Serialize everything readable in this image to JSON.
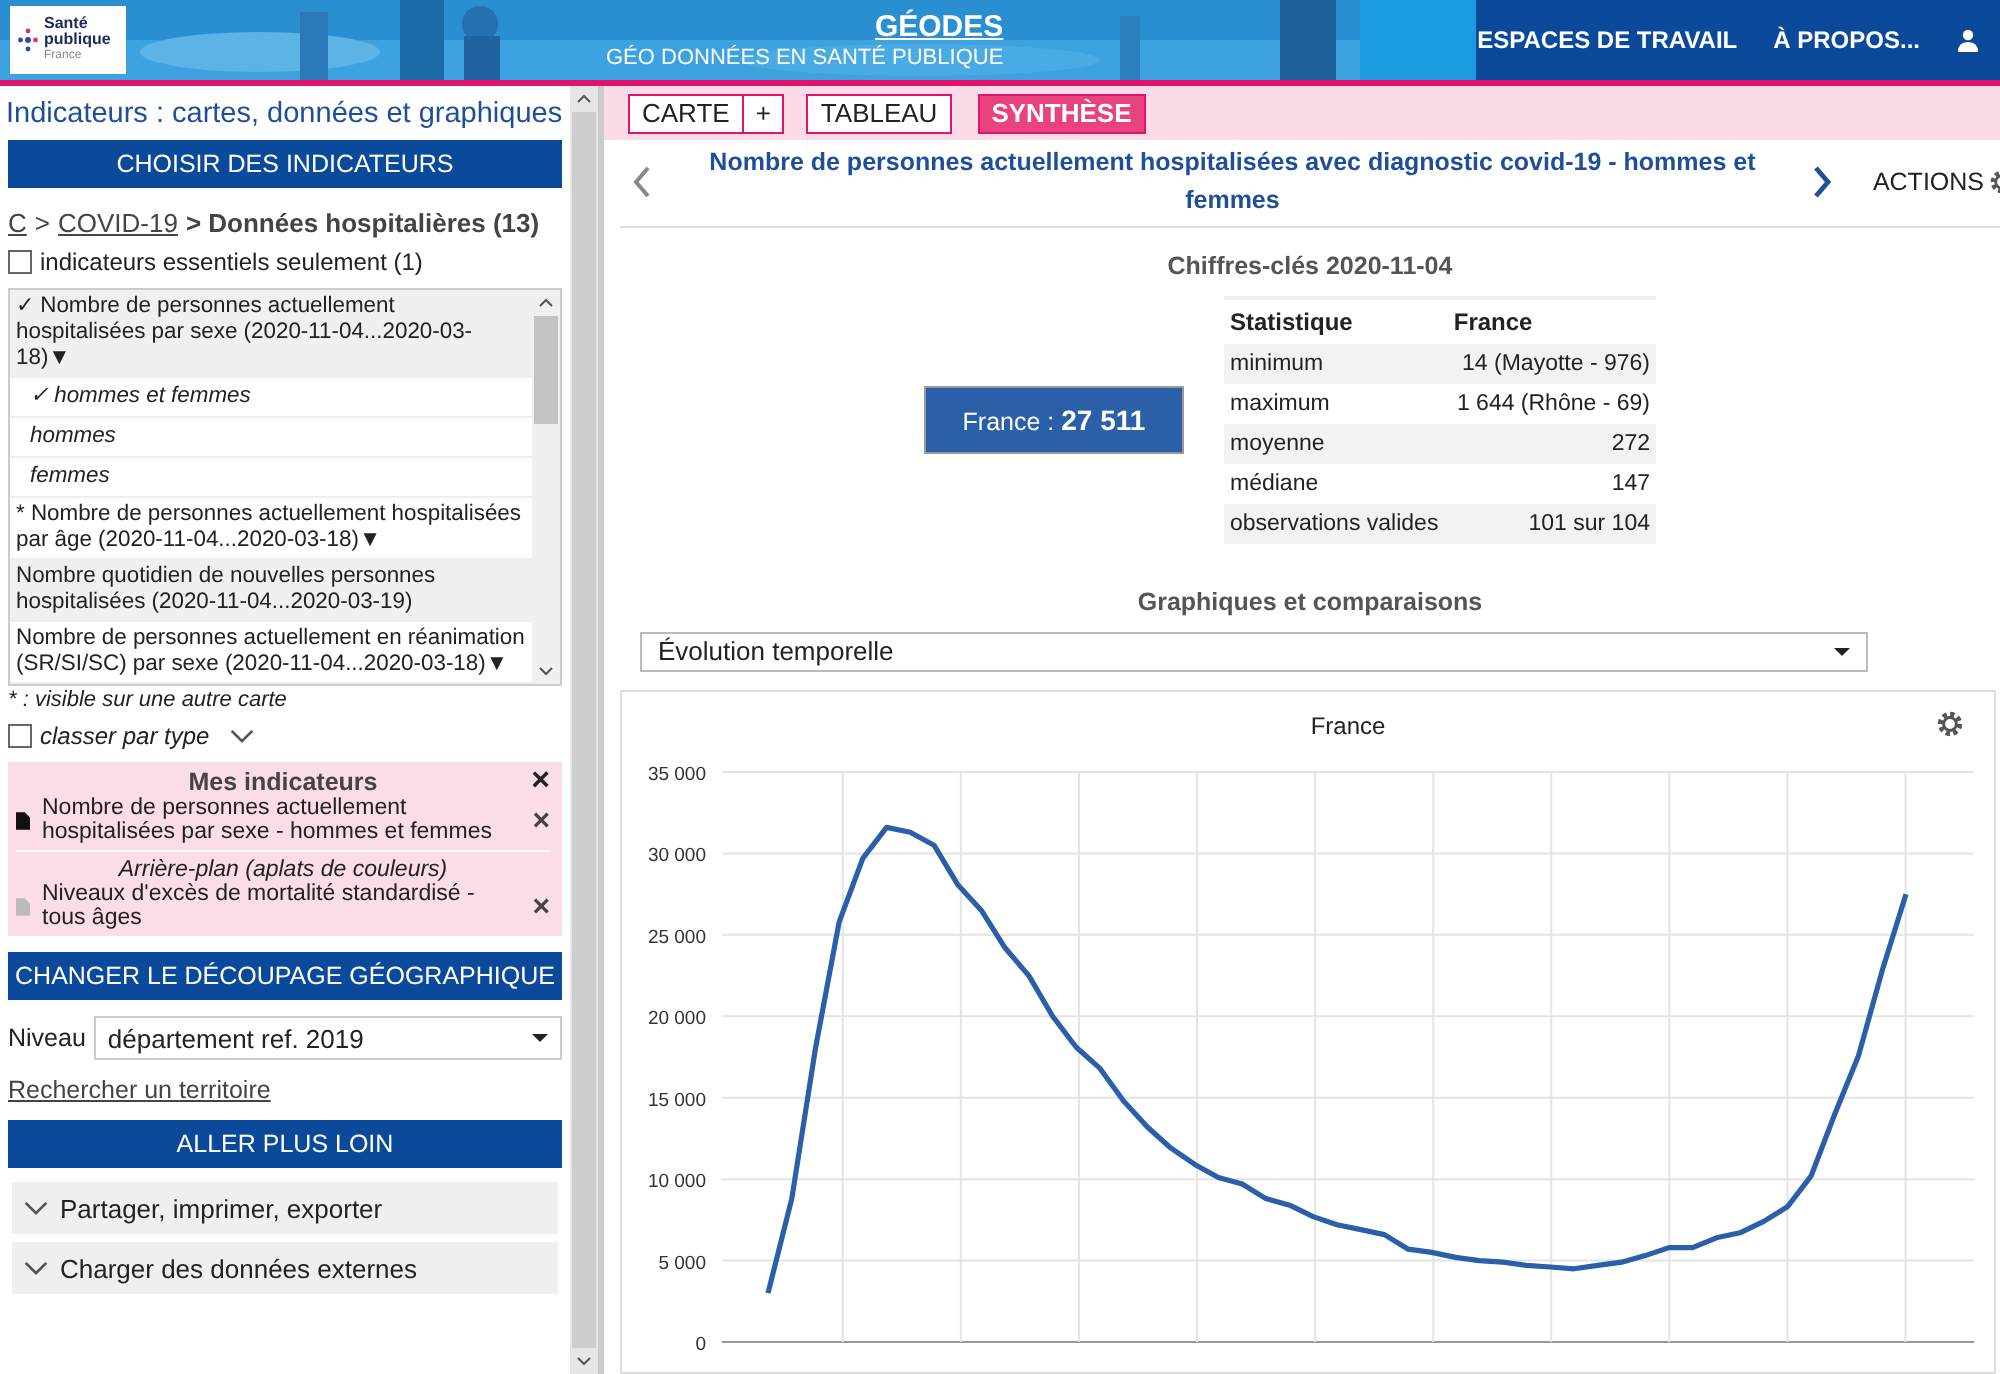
{
  "header": {
    "logo_lines": [
      "Santé",
      "publique",
      "France"
    ],
    "app_title": "GÉODES",
    "app_subtitle": "GÉO DONNÉES EN SANTÉ PUBLIQUE",
    "nav": [
      "ESPACES DE TRAVAIL",
      "À PROPOS..."
    ]
  },
  "sidebar": {
    "title": "Indicateurs : cartes, données et graphiques",
    "choose_button": "CHOISIR DES INDICATEURS",
    "breadcrumb": [
      {
        "text": "C",
        "kind": "link"
      },
      {
        "text": ">",
        "kind": "sep"
      },
      {
        "text": "COVID-19",
        "kind": "link"
      },
      {
        "text": "> Données hospitalières (13)",
        "kind": "current"
      }
    ],
    "essential_filter": {
      "label": "indicateurs essentiels seulement (1)",
      "checked": false
    },
    "indicators": [
      {
        "kind": "group",
        "text": "✓ Nombre de personnes actuellement hospitalisées par sexe (2020-11-04...2020-03-18)",
        "arrow": "▼",
        "shaded": true
      },
      {
        "kind": "option",
        "text": "✓ hommes et femmes"
      },
      {
        "kind": "option",
        "text": "hommes"
      },
      {
        "kind": "option",
        "text": "femmes"
      },
      {
        "kind": "group",
        "text": "* Nombre de personnes actuellement hospitalisées par âge (2020-11-04...2020-03-18)",
        "arrow": "▼",
        "shaded": false
      },
      {
        "kind": "group",
        "text": "Nombre quotidien de nouvelles personnes hospitalisées (2020-11-04...2020-03-19)",
        "shaded": true
      },
      {
        "kind": "group",
        "text": "Nombre de personnes actuellement en réanimation (SR/SI/SC) par sexe (2020-11-04...2020-03-18)",
        "arrow": "▼",
        "shaded": false
      }
    ],
    "footnote": "* : visible sur une autre carte",
    "sort_by_type": {
      "label": "classer par type",
      "checked": false
    },
    "my_indicators": {
      "title": "Mes indicateurs",
      "close": "×",
      "items": [
        {
          "kind": "main",
          "text": "Nombre de personnes actuellement hospitalisées par sexe - hommes et femmes",
          "remove": "×"
        },
        {
          "kind": "background",
          "heading": "Arrière-plan (aplats de couleurs)",
          "text": "Niveaux d'excès de mortalité standardisé - tous âges",
          "remove": "×"
        }
      ]
    },
    "geo_button": "CHANGER LE DÉCOUPAGE GÉOGRAPHIQUE",
    "level": {
      "label": "Niveau",
      "value": "département ref. 2019"
    },
    "search_link": "Rechercher un territoire",
    "more_button": "ALLER PLUS LOIN",
    "accordions": [
      "Partager, imprimer, exporter",
      "Charger des données externes"
    ]
  },
  "main": {
    "tabs": [
      {
        "label": "CARTE",
        "selected": false
      },
      {
        "label": "+",
        "selected": false
      },
      {
        "label": "TABLEAU",
        "selected": false
      },
      {
        "label": "SYNTHÈSE",
        "selected": true
      }
    ],
    "indicator_title": "Nombre de personnes actuellement hospitalisées avec diagnostic covid-19 - hommes et femmes",
    "actions": "ACTIONS",
    "key_figures": {
      "title": "Chiffres-clés 2020-11-04",
      "total_label": "France : ",
      "total_value": "27 511",
      "columns": [
        "Statistique",
        "France"
      ],
      "rows": [
        [
          "minimum",
          "14 (Mayotte - 976)"
        ],
        [
          "maximum",
          "1 644 (Rhône - 69)"
        ],
        [
          "moyenne",
          "272"
        ],
        [
          "médiane",
          "147"
        ],
        [
          "observations valides",
          "101 sur 104"
        ]
      ]
    },
    "charts_title": "Graphiques et comparaisons",
    "chart_select": "Évolution temporelle",
    "chart_data": {
      "type": "line",
      "title": "France",
      "ylim": [
        0,
        35000
      ],
      "grid": true,
      "yticks": [
        {
          "value": 0,
          "label": "0"
        },
        {
          "value": 5000,
          "label": "5 000"
        },
        {
          "value": 10000,
          "label": "10 000"
        },
        {
          "value": 15000,
          "label": "15 000"
        },
        {
          "value": 20000,
          "label": "20 000"
        },
        {
          "value": 25000,
          "label": "25 000"
        },
        {
          "value": 30000,
          "label": "30 000"
        },
        {
          "value": 35000,
          "label": "35 000"
        }
      ],
      "categories": [
        null,
        null,
        null,
        null,
        null,
        null,
        null,
        null,
        null,
        null,
        null,
        null,
        null,
        null,
        null,
        null,
        null,
        null,
        null,
        null,
        null,
        null,
        null,
        null,
        null,
        null,
        null,
        null,
        null,
        null,
        null,
        null,
        null,
        null,
        null,
        null,
        null,
        null,
        null,
        null,
        null,
        null,
        null,
        null,
        null,
        null,
        null,
        null,
        null
      ],
      "series": [
        {
          "color": "#2b5fa8",
          "values": [
            3000,
            8800,
            18000,
            25800,
            29700,
            31600,
            31300,
            30500,
            28100,
            26500,
            24200,
            22500,
            20000,
            18100,
            16800,
            14800,
            13200,
            11900,
            10900,
            10100,
            9700,
            8800,
            8400,
            7700,
            7200,
            6900,
            6600,
            5700,
            5500,
            5200,
            5000,
            4900,
            4700,
            4600,
            4500,
            4700,
            4900,
            5300,
            5800,
            5800,
            6400,
            6700,
            7400,
            8300,
            10200,
            14000,
            17600,
            22800,
            27500
          ]
        }
      ]
    }
  }
}
